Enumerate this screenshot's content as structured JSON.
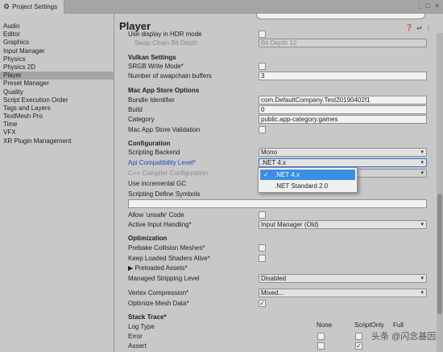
{
  "window": {
    "tab_title": "Project Settings",
    "menu_icon": "⋮",
    "maximize_icon": "□",
    "close_icon": "×"
  },
  "sidebar": {
    "items": [
      {
        "label": "Audio"
      },
      {
        "label": "Editor"
      },
      {
        "label": "Graphics"
      },
      {
        "label": "Input Manager"
      },
      {
        "label": "Physics"
      },
      {
        "label": "Physics 2D"
      },
      {
        "label": "Player",
        "selected": true
      },
      {
        "label": "Preset Manager"
      },
      {
        "label": "Quality"
      },
      {
        "label": "Script Execution Order"
      },
      {
        "label": "Tags and Layers"
      },
      {
        "label": "TextMesh Pro"
      },
      {
        "label": "Time"
      },
      {
        "label": "VFX"
      },
      {
        "label": "XR Plugin Management"
      }
    ]
  },
  "main": {
    "title": "Player",
    "search_placeholder": "",
    "header_icons": [
      "❓",
      "⇌",
      "⋮"
    ],
    "hdr_mode": {
      "label": "Use display in HDR mode"
    },
    "swap_chain": {
      "label": "Swap Chain Bit Depth",
      "value": "Bit Depth 10"
    },
    "vulkan": {
      "header": "Vulkan Settings",
      "srgb_label": "SRGB Write Mode*",
      "swapchain_label": "Number of swapchain buffers",
      "swapchain_value": "3"
    },
    "mac": {
      "header": "Mac App Store Options",
      "bundle_label": "Bundle Identifier",
      "bundle_value": "com.DefaultCompany.Test20190402f1",
      "build_label": "Build",
      "build_value": "0",
      "category_label": "Category",
      "category_value": "public.app-category.games",
      "validation_label": "Mac App Store Validation"
    },
    "config": {
      "header": "Configuration",
      "backend_label": "Scripting Backend",
      "backend_value": "Mono",
      "api_label": "Api Compatibility Level*",
      "api_value": ".NET 4.x",
      "cpp_label": "C++ Compiler Configuration",
      "incremental_gc_label": "Use incremental GC",
      "define_label": "Scripting Define Symbols",
      "define_value": "",
      "unsafe_label": "Allow 'unsafe' Code",
      "input_label": "Active Input Handling*",
      "input_value": "Input Manager (Old)"
    },
    "optimization": {
      "header": "Optimization",
      "prebake_label": "Prebake Collision Meshes*",
      "keep_shaders_label": "Keep Loaded Shaders Alive*",
      "preloaded_label": "▶ Preloaded Assets*",
      "stripping_label": "Managed Stripping Level",
      "stripping_value": "Disabled",
      "vertex_label": "Vertex Compression*",
      "vertex_value": "Mixed...",
      "optimize_mesh_label": "Optimize Mesh Data*"
    },
    "stack_trace": {
      "header": "Stack Trace*",
      "log_type_label": "Log Type",
      "col_none": "None",
      "col_script_only": "ScriptOnly",
      "col_full": "Full",
      "error_label": "Error",
      "assert_label": "Assert"
    },
    "api_popup": {
      "options": [
        ".NET 4.x",
        ".NET Standard 2.0"
      ],
      "selected_index": 0
    },
    "caret": "▾",
    "check": "✓"
  },
  "watermark": "头条 @闪念基因"
}
